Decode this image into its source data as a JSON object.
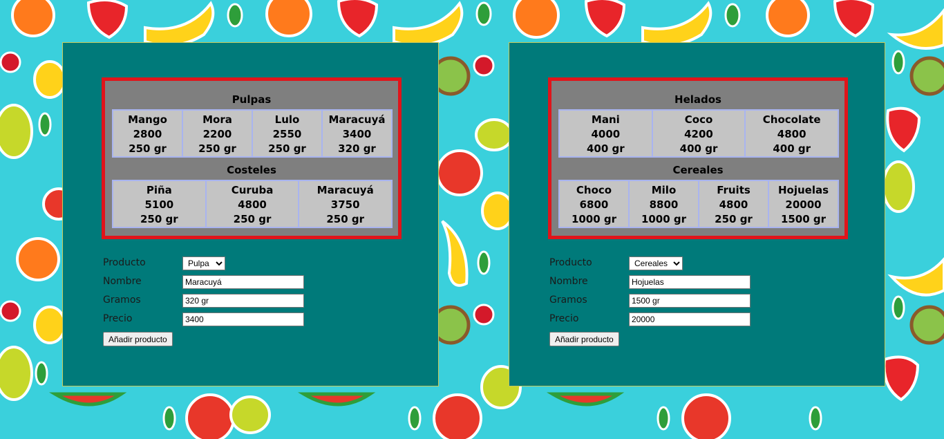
{
  "left": {
    "top_category": {
      "title": "Pulpas",
      "items": [
        {
          "name": "Mango",
          "price": "2800",
          "weight": "250 gr"
        },
        {
          "name": "Mora",
          "price": "2200",
          "weight": "250 gr"
        },
        {
          "name": "Lulo",
          "price": "2550",
          "weight": "250 gr"
        },
        {
          "name": "Maracuyá",
          "price": "3400",
          "weight": "320 gr"
        }
      ]
    },
    "bottom_category": {
      "title": "Costeles",
      "items": [
        {
          "name": "Piña",
          "price": "5100",
          "weight": "250 gr"
        },
        {
          "name": "Curuba",
          "price": "4800",
          "weight": "250 gr"
        },
        {
          "name": "Maracuyá",
          "price": "3750",
          "weight": "250 gr"
        }
      ]
    },
    "form": {
      "producto_label": "Producto",
      "producto_value": "Pulpa",
      "nombre_label": "Nombre",
      "nombre_value": "Maracuyá",
      "gramos_label": "Gramos",
      "gramos_value": "320 gr",
      "precio_label": "Precio",
      "precio_value": "3400",
      "button": "Añadir producto"
    }
  },
  "right": {
    "top_category": {
      "title": "Helados",
      "items": [
        {
          "name": "Mani",
          "price": "4000",
          "weight": "400 gr"
        },
        {
          "name": "Coco",
          "price": "4200",
          "weight": "400 gr"
        },
        {
          "name": "Chocolate",
          "price": "4800",
          "weight": "400 gr"
        }
      ]
    },
    "bottom_category": {
      "title": "Cereales",
      "items": [
        {
          "name": "Choco",
          "price": "6800",
          "weight": "1000 gr"
        },
        {
          "name": "Milo",
          "price": "8800",
          "weight": "1000 gr"
        },
        {
          "name": "Fruits",
          "price": "4800",
          "weight": "250 gr"
        },
        {
          "name": "Hojuelas",
          "price": "20000",
          "weight": "1500 gr"
        }
      ]
    },
    "form": {
      "producto_label": "Producto",
      "producto_value": "Cereales",
      "nombre_label": "Nombre",
      "nombre_value": "Hojuelas",
      "gramos_label": "Gramos",
      "gramos_value": "1500 gr",
      "precio_label": "Precio",
      "precio_value": "20000",
      "button": "Añadir producto"
    }
  },
  "colors": {
    "background": "#3ad0dc",
    "panel": "#007a7a",
    "box_border": "#e0141a",
    "box_fill": "#7f7f7f",
    "cell_fill": "#c4c4c4",
    "cell_border": "#a9b4f0"
  },
  "background_pattern": "fruit-pattern"
}
